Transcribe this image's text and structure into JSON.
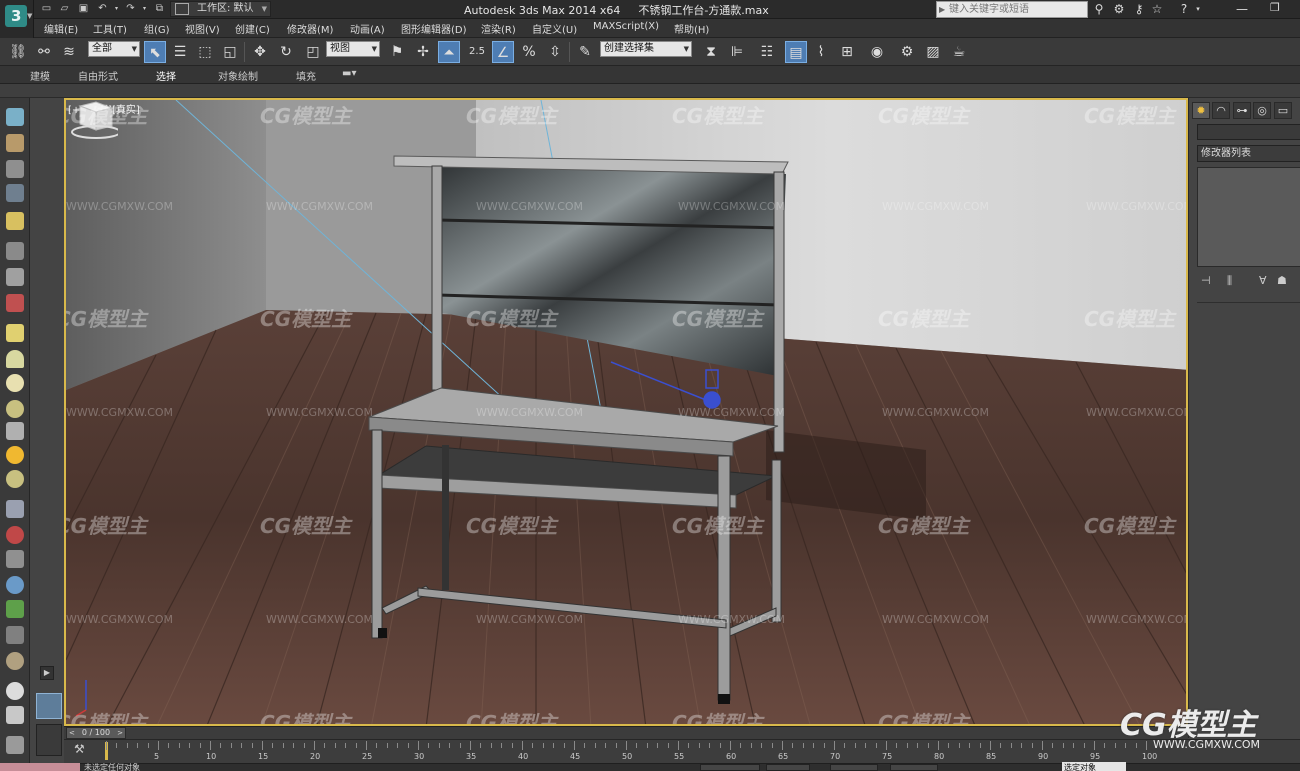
{
  "title_bar": {
    "workspace_label": "工作区: 默认",
    "app_title": "Autodesk 3ds Max  2014 x64",
    "file_name": "不锈钢工作台-方通款.max",
    "search_placeholder": "键入关键字或短语",
    "quick_access_icons": [
      "new-icon",
      "open-icon",
      "save-icon",
      "undo-icon",
      "redo-icon",
      "hold-icon"
    ],
    "right_icons": [
      "binoculars-icon",
      "exchange-icon",
      "key-icon",
      "star-icon",
      "help-icon"
    ]
  },
  "menu": {
    "items": [
      "编辑(E)",
      "工具(T)",
      "组(G)",
      "视图(V)",
      "创建(C)",
      "修改器(M)",
      "动画(A)",
      "图形编辑器(D)",
      "渲染(R)",
      "自定义(U)",
      "MAXScript(X)",
      "帮助(H)"
    ]
  },
  "toolbar": {
    "selection_filter": "全部",
    "reference_coord": "视图",
    "snap_label": "2.5",
    "named_selection_placeholder": "创建选择集"
  },
  "ribbon": {
    "tabs": [
      "建模",
      "自由形式",
      "选择",
      "对象绘制",
      "填充"
    ],
    "active_tab": "选择"
  },
  "viewport": {
    "label": "[+][透视][真实]",
    "watermark_brand": "CG模型主",
    "watermark_url": "WWW.CGMXW.COM"
  },
  "command_panel": {
    "modifier_list": "修改器列表"
  },
  "timeline": {
    "frame_display": "0 / 100",
    "ticks": [
      "5",
      "10",
      "15",
      "20",
      "25",
      "30",
      "35",
      "40",
      "45",
      "50",
      "55",
      "60",
      "65",
      "70",
      "75",
      "80",
      "85",
      "90",
      "95",
      "100"
    ]
  },
  "status": {
    "prompt": "未选定任何对象",
    "selection_mode": "选定对象"
  },
  "corner_watermark": {
    "brand": "CG模型主",
    "url": "WWW.CGMXW.COM"
  },
  "colors": {
    "viewport_border": "#d9b94b",
    "active_button": "#4e7db3",
    "maxscript_listener": "#c78e98"
  }
}
